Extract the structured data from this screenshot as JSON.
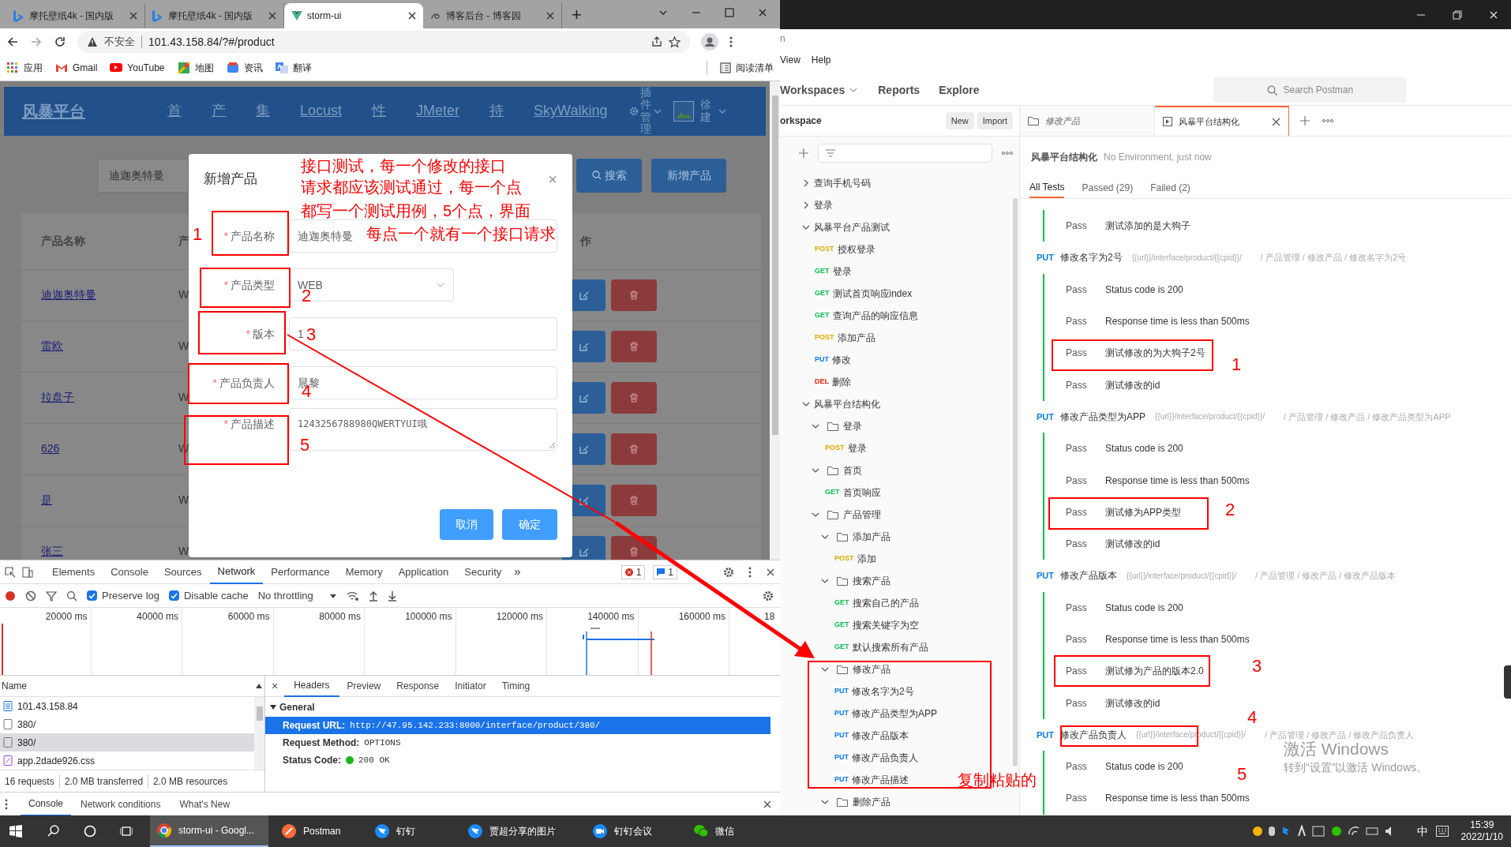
{
  "browser": {
    "tabs": [
      {
        "title": "摩托壁纸4k - 国内版",
        "selected": false,
        "kind": "bing"
      },
      {
        "title": "摩托壁纸4k - 国内版",
        "selected": false,
        "kind": "bing"
      },
      {
        "title": "storm-ui",
        "selected": true,
        "kind": "vue"
      },
      {
        "title": "博客后台 - 博客园",
        "selected": false,
        "kind": "blog"
      }
    ],
    "new_tab": "+",
    "address": {
      "security": "不安全",
      "url": "101.43.158.84/?#/product"
    },
    "bookmarks": [
      {
        "label": "应用",
        "kind": "apps"
      },
      {
        "label": "Gmail",
        "kind": "gmail"
      },
      {
        "label": "YouTube",
        "kind": "youtube"
      },
      {
        "label": "地图",
        "kind": "maps"
      },
      {
        "label": "资讯",
        "kind": "news"
      },
      {
        "label": "翻译",
        "kind": "translate"
      }
    ],
    "reading_list": "阅读清单"
  },
  "app": {
    "logo": "风暴平台",
    "nav": [
      "首",
      "产",
      "集",
      "Locust",
      "性",
      "JMeter",
      "持",
      "SkyWalking"
    ],
    "plugin_menu": "插件管理",
    "user": "徐建",
    "search": {
      "value": "迪迦奥特曼"
    },
    "search_button": "搜索",
    "add_button": "新增产品",
    "table": {
      "columns": [
        "产品名称",
        "产",
        "作"
      ],
      "rows": [
        {
          "name": "迪迦奥特曼",
          "column_2": "W"
        },
        {
          "name": "雷欧",
          "column_2": "W"
        },
        {
          "name": "拉盘子",
          "column_2": "W"
        },
        {
          "name": "626",
          "column_2": "W"
        },
        {
          "name": "是",
          "column_2": "W"
        },
        {
          "name": "张三",
          "column_2": "W"
        }
      ]
    }
  },
  "dialog": {
    "title": "新增产品",
    "close": "×",
    "fields": [
      {
        "label": "产品名称",
        "required_mark": "*",
        "kind": "input",
        "value": "迪迦奥特曼"
      },
      {
        "label": "产品类型",
        "required_mark": "*",
        "kind": "select",
        "value": "WEB"
      },
      {
        "label": "版本",
        "required_mark": "*",
        "kind": "input",
        "value": "1"
      },
      {
        "label": "产品负责人",
        "required_mark": "*",
        "kind": "input",
        "value": "晨黎"
      },
      {
        "label": "产品描述",
        "required_mark": "*",
        "kind": "textarea",
        "value": "1243256788980QWERTYUI哦"
      }
    ],
    "buttons": [
      "取消",
      "确定"
    ]
  },
  "devtools": {
    "tabs": [
      {
        "label": "Elements",
        "selected": false
      },
      {
        "label": "Console",
        "selected": false
      },
      {
        "label": "Sources",
        "selected": false
      },
      {
        "label": "Network",
        "selected": true
      },
      {
        "label": "Performance",
        "selected": false
      },
      {
        "label": "Memory",
        "selected": false
      },
      {
        "label": "Application",
        "selected": false
      },
      {
        "label": "Security",
        "selected": false
      }
    ],
    "more_tabs": "»",
    "errors": "1",
    "messages": "1",
    "preserve_log": {
      "label": "Preserve log",
      "checked": true
    },
    "disable_cache": {
      "label": "Disable cache",
      "checked": true
    },
    "throttling": "No throttling",
    "overview_ticks": [
      "20000 ms",
      "40000 ms",
      "60000 ms",
      "80000 ms",
      "100000 ms",
      "120000 ms",
      "140000 ms",
      "160000 ms",
      "18"
    ],
    "name_header": "Name",
    "requests": [
      {
        "name": "101.43.158.84",
        "kind": "document",
        "selected": false
      },
      {
        "name": "380/",
        "kind": "fetch",
        "selected": false
      },
      {
        "name": "380/",
        "kind": "fetch",
        "selected": true
      },
      {
        "name": "app.2dade926.css",
        "kind": "stylesheet",
        "selected": false
      }
    ],
    "summary": [
      "16 requests",
      "2.0 MB transferred",
      "2.0 MB resources"
    ],
    "detail_close": "×",
    "detail_tabs": [
      {
        "label": "Headers",
        "selected": true
      },
      {
        "label": "Preview",
        "selected": false
      },
      {
        "label": "Response",
        "selected": false
      },
      {
        "label": "Initiator",
        "selected": false
      },
      {
        "label": "Timing",
        "selected": false
      }
    ],
    "general": {
      "title": "General",
      "rows": [
        {
          "key": "Request URL:",
          "value": "http://47.95.142.233:8000/interface/product/380/",
          "selected": true
        },
        {
          "key": "Request Method:",
          "value": "OPTIONS",
          "selected": false
        },
        {
          "key": "Status Code:",
          "value": "200 OK",
          "selected": false,
          "color": "#1db31d"
        }
      ]
    },
    "drawer_tabs": [
      {
        "label": "Console",
        "selected": true
      },
      {
        "label": "Network conditions",
        "selected": false
      },
      {
        "label": "What's New",
        "selected": false
      }
    ]
  },
  "postman": {
    "title_fragment": "n",
    "menu": [
      "View",
      "Help"
    ],
    "nav": [
      "Workspaces",
      "Reports",
      "Explore"
    ],
    "search": {
      "placeholder": "Search Postman"
    },
    "sidebar": {
      "title": "orkspace",
      "buttons": [
        "New",
        "Import"
      ],
      "tree": [
        {
          "kind": "collection",
          "label": "查询手机号码",
          "expanded": false
        },
        {
          "kind": "collection",
          "label": "登录",
          "expanded": false
        },
        {
          "kind": "collection",
          "label": "风暴平台产品测试",
          "expanded": true,
          "children": [
            {
              "kind": "request",
              "method": "POST",
              "label": "授权登录"
            },
            {
              "kind": "request",
              "method": "GET",
              "label": "登录"
            },
            {
              "kind": "request",
              "method": "GET",
              "label": "测试首页响应index"
            },
            {
              "kind": "request",
              "method": "GET",
              "label": "查询产品的响应信息"
            },
            {
              "kind": "request",
              "method": "POST",
              "label": "添加产品"
            },
            {
              "kind": "request",
              "method": "PUT",
              "label": "修改"
            },
            {
              "kind": "request",
              "method": "DEL",
              "label": "删除"
            }
          ]
        },
        {
          "kind": "collection",
          "label": "风暴平台结构化",
          "expanded": true,
          "children": [
            {
              "kind": "folder",
              "label": "登录",
              "expanded": true,
              "children": [
                {
                  "kind": "request",
                  "method": "POST",
                  "label": "登录"
                }
              ]
            },
            {
              "kind": "folder",
              "label": "首页",
              "expanded": true,
              "children": [
                {
                  "kind": "request",
                  "method": "GET",
                  "label": "首页响应"
                }
              ]
            },
            {
              "kind": "folder",
              "label": "产品管理",
              "expanded": true,
              "children": [
                {
                  "kind": "folder",
                  "label": "添加产品",
                  "expanded": true,
                  "children": [
                    {
                      "kind": "request",
                      "method": "POST",
                      "label": "添加"
                    }
                  ]
                },
                {
                  "kind": "folder",
                  "label": "搜索产品",
                  "expanded": true,
                  "children": [
                    {
                      "kind": "request",
                      "method": "GET",
                      "label": "搜索自己的产品"
                    },
                    {
                      "kind": "request",
                      "method": "GET",
                      "label": "搜索关键字为空"
                    },
                    {
                      "kind": "request",
                      "method": "GET",
                      "label": "默认搜索所有产品"
                    }
                  ]
                },
                {
                  "kind": "folder",
                  "label": "修改产品",
                  "expanded": true,
                  "children": [
                    {
                      "kind": "request",
                      "method": "PUT",
                      "label": "修改名字为2号"
                    },
                    {
                      "kind": "request",
                      "method": "PUT",
                      "label": "修改产品类型为APP"
                    },
                    {
                      "kind": "request",
                      "method": "PUT",
                      "label": "修改产品版本"
                    },
                    {
                      "kind": "request",
                      "method": "PUT",
                      "label": "修改产品负责人"
                    },
                    {
                      "kind": "request",
                      "method": "PUT",
                      "label": "修改产品描述"
                    }
                  ]
                },
                {
                  "kind": "folder",
                  "label": "删除产品",
                  "expanded": true
                }
              ]
            }
          ]
        }
      ]
    },
    "tabs": [
      {
        "label": "修改产品",
        "kind": "folder",
        "selected": false
      },
      {
        "label": "风暴平台结构化",
        "kind": "runner",
        "selected": true
      }
    ],
    "runner": {
      "title": "风暴平台结构化",
      "meta": "No Environment, just now",
      "filters": [
        {
          "label": "All Tests",
          "selected": true
        },
        {
          "label": "Passed (29)",
          "selected": false
        },
        {
          "label": "Failed (2)",
          "selected": false
        }
      ],
      "groups": [
        {
          "tests": [
            {
              "status": "Pass",
              "name": "测试添加的是大狗子"
            }
          ]
        },
        {
          "method": "PUT",
          "name": "修改名字为2号",
          "url": "{{url}}/interface/product/{{cpid}}/",
          "path": "/ 产品管理 / 修改产品 / 修改名字为2号",
          "tests": [
            {
              "status": "Pass",
              "name": "Status code is 200"
            },
            {
              "status": "Pass",
              "name": "Response time is less than 500ms"
            },
            {
              "status": "Pass",
              "name": "测试修改的为大狗子2号"
            },
            {
              "status": "Pass",
              "name": "测试修改的id"
            }
          ]
        },
        {
          "method": "PUT",
          "name": "修改产品类型为APP",
          "url": "{{url}}/interface/product/{{cpid}}/",
          "path": "/ 产品管理 / 修改产品 / 修改产品类型为APP",
          "tests": [
            {
              "status": "Pass",
              "name": "Status code is 200"
            },
            {
              "status": "Pass",
              "name": "Response time is less than 500ms"
            },
            {
              "status": "Pass",
              "name": "测试修为APP类型"
            },
            {
              "status": "Pass",
              "name": "测试修改的id"
            }
          ]
        },
        {
          "method": "PUT",
          "name": "修改产品版本",
          "url": "{{url}}/interface/product/{{cpid}}/",
          "path": "/ 产品管理 / 修改产品 / 修改产品版本",
          "tests": [
            {
              "status": "Pass",
              "name": "Status code is 200"
            },
            {
              "status": "Pass",
              "name": "Response time is less than 500ms"
            },
            {
              "status": "Pass",
              "name": "测试修为产品的版本2.0"
            },
            {
              "status": "Pass",
              "name": "测试修改的id"
            }
          ]
        },
        {
          "method": "PUT",
          "name": "修改产品负责人",
          "url": "{{url}}/interface/product/{{cpid}}/",
          "path": "/ 产品管理 / 修改产品 / 修改产品负责人",
          "tests": [
            {
              "status": "Pass",
              "name": "Status code is 200"
            },
            {
              "status": "Pass",
              "name": "Response time is less than 500ms"
            }
          ]
        }
      ]
    }
  },
  "os_watermark": {
    "title": "激活 Windows",
    "hint": "转到“设置”以激活 Windows。"
  },
  "annotations": {
    "note_lines": [
      "接口测试，每一个修改的接口",
      "请求都应该测试通过，每一个点",
      "都写一个测试用例，5个点，界面",
      "每点一个就有一个接口请求"
    ],
    "dialog_numbers": [
      "1",
      "2",
      "3",
      "4",
      "5"
    ],
    "postman_numbers": [
      "1",
      "2",
      "3",
      "4",
      "5"
    ],
    "copy_note": "复制粘贴的"
  },
  "taskbar": {
    "apps": [
      {
        "label": "storm-ui - Googl...",
        "kind": "chrome",
        "selected": true
      },
      {
        "label": "Postman",
        "kind": "postman",
        "selected": false
      },
      {
        "label": "钉钉",
        "kind": "dingtalk",
        "selected": false
      },
      {
        "label": "贾超分享的图片",
        "kind": "dingtalk",
        "selected": false
      },
      {
        "label": "钉钉会议",
        "kind": "meeting",
        "selected": false
      },
      {
        "label": "微信",
        "kind": "wechat",
        "selected": false
      }
    ],
    "ime": "中",
    "time": "15:39",
    "date": "2022/1/10"
  }
}
